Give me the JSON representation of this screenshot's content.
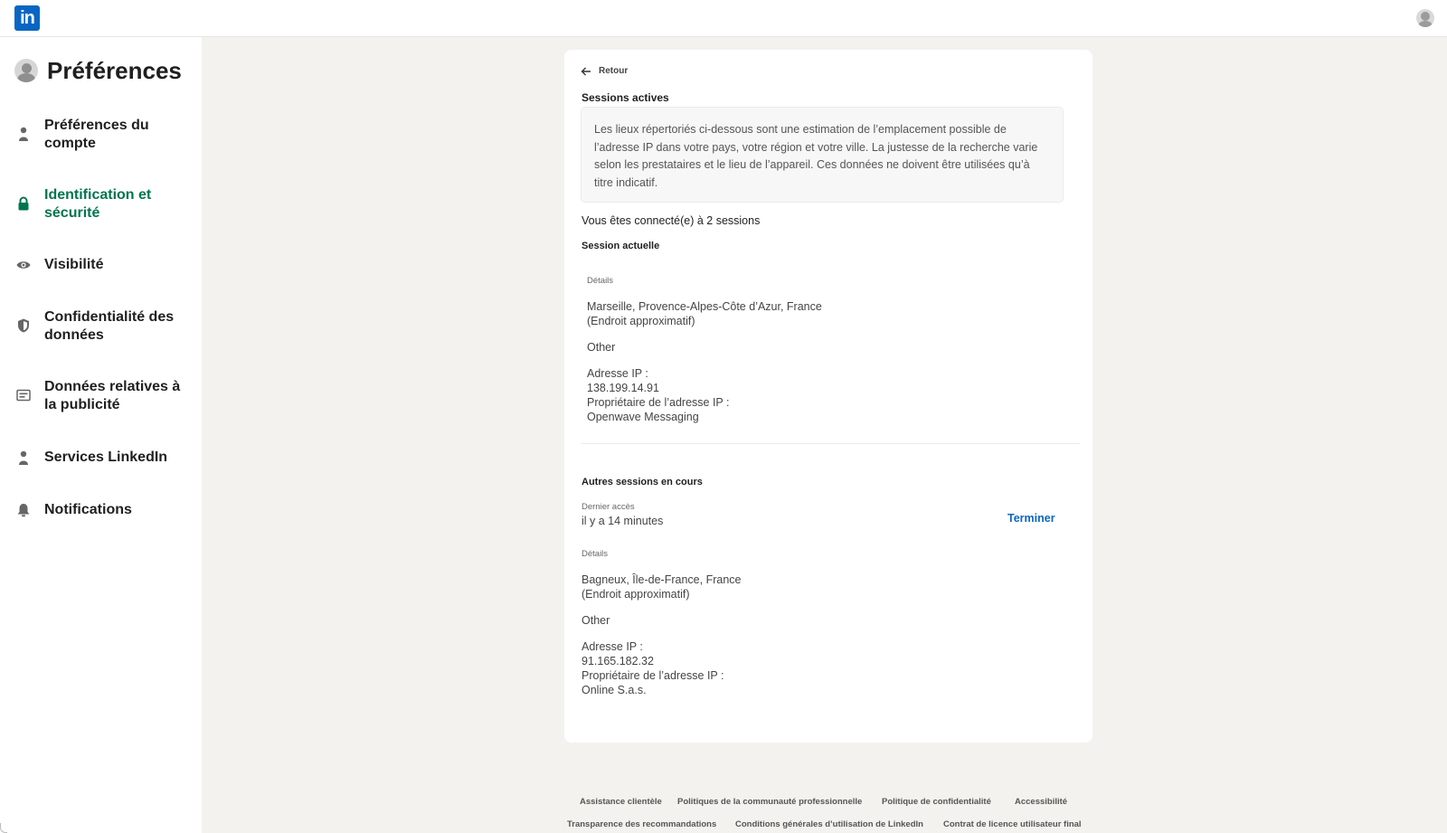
{
  "app": {
    "logo_text": "in",
    "brand_color": "#0a66c2",
    "accent_green": "#01754f"
  },
  "sidebar": {
    "title": "Préférences",
    "items": [
      {
        "label": "Préférences du compte",
        "icon": "person-icon",
        "active": false
      },
      {
        "label": "Identification et sécurité",
        "icon": "lock-icon",
        "active": true
      },
      {
        "label": "Visibilité",
        "icon": "eye-icon",
        "active": false
      },
      {
        "label": "Confidentialité des données",
        "icon": "shield-icon",
        "active": false
      },
      {
        "label": "Données relatives à la publicité",
        "icon": "ad-card-icon",
        "active": false
      },
      {
        "label": "Services LinkedIn",
        "icon": "person-icon",
        "active": false
      },
      {
        "label": "Notifications",
        "icon": "bell-icon",
        "active": false
      }
    ]
  },
  "main": {
    "back_label": "Retour",
    "section_title": "Sessions actives",
    "info_text": "Les lieux répertoriés ci-dessous sont une estimation de l’emplacement possible de l’adresse IP dans votre pays, votre région et votre ville. La justesse de la recherche varie selon les prestataires et le lieu de l’appareil. Ces données ne doivent être utilisées qu’à titre indicatif.",
    "connected_text": "Vous êtes connecté(e) à 2 sessions",
    "current_session": {
      "heading": "Session actuelle",
      "details_label": "Détails",
      "location": "Marseille, Provence-Alpes-Côte d’Azur, France",
      "approx": "(Endroit approximatif)",
      "device": "Other",
      "ip_label": "Adresse IP :",
      "ip": "138.199.14.91",
      "owner_label": "Propriétaire de l’adresse IP :",
      "owner": "Openwave Messaging"
    },
    "other_sessions": {
      "heading": "Autres sessions en cours",
      "last_access_label": "Dernier accès",
      "last_access": "il y a 14 minutes",
      "terminate_label": "Terminer",
      "details_label": "Détails",
      "location": "Bagneux, Île-de-France, France",
      "approx": "(Endroit approximatif)",
      "device": "Other",
      "ip_label": "Adresse IP :",
      "ip": "91.165.182.32",
      "owner_label": "Propriétaire de l’adresse IP :",
      "owner": "Online S.a.s."
    }
  },
  "footer": {
    "links": [
      "Assistance clientèle",
      "Politiques de la communauté professionnelle",
      "Politique de confidentialité",
      "Accessibilité",
      "Transparence des recommandations",
      "Conditions générales d’utilisation de LinkedIn",
      "Contrat de licence utilisateur final"
    ]
  }
}
